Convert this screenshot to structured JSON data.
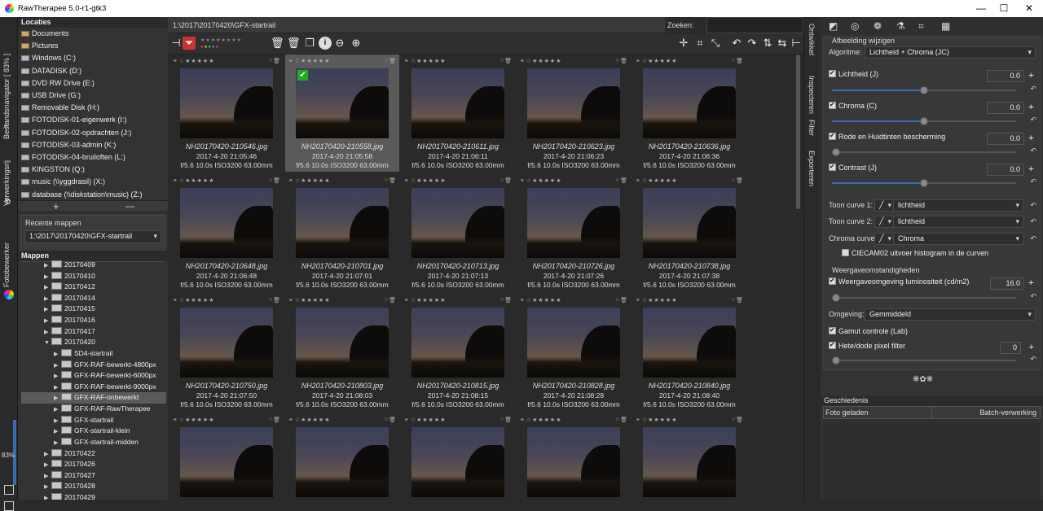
{
  "window": {
    "title": "RawTherapee 5.0-r1-gtk3",
    "controls": [
      "—",
      "☐",
      "✕"
    ]
  },
  "left_tabs": {
    "file_browser": "Bestandsnavigator [ 83% ]",
    "queue": "Verwerkingsrij",
    "editor": "Fotobewerker",
    "zoom_percent": "83%"
  },
  "places": {
    "header": "Locaties",
    "items": [
      {
        "label": "Documents",
        "kind": "folder"
      },
      {
        "label": "Pictures",
        "kind": "folder"
      },
      {
        "label": "Windows (C:)",
        "kind": "drive"
      },
      {
        "label": "DATADISK (D:)",
        "kind": "drive"
      },
      {
        "label": "DVD RW Drive (E:)",
        "kind": "drive"
      },
      {
        "label": "USB Drive (G:)",
        "kind": "drive"
      },
      {
        "label": "Removable Disk (H:)",
        "kind": "drive"
      },
      {
        "label": "FOTODISK-01-eigenwerk (I:)",
        "kind": "drive"
      },
      {
        "label": "FOTODISK-02-opdrachten (J:)",
        "kind": "drive"
      },
      {
        "label": "FOTODISK-03-admin (K:)",
        "kind": "drive"
      },
      {
        "label": "FOTODISK-04-bruiloften (L:)",
        "kind": "drive"
      },
      {
        "label": "KINGSTON (Q:)",
        "kind": "drive"
      },
      {
        "label": "music (\\\\yggdrasil) (X:)",
        "kind": "drive"
      },
      {
        "label": "database (\\\\diskstation\\music) (Z:)",
        "kind": "drive"
      }
    ],
    "add": "+",
    "remove": "—"
  },
  "recent": {
    "header": "Recente mappen",
    "value": "1:\\2017\\20170420\\GFX-startrail"
  },
  "tree": {
    "header": "Mappen",
    "nodes": [
      {
        "label": "20170409",
        "depth": 0,
        "open": false
      },
      {
        "label": "20170410",
        "depth": 0,
        "open": false
      },
      {
        "label": "20170412",
        "depth": 0,
        "open": false
      },
      {
        "label": "20170414",
        "depth": 0,
        "open": false
      },
      {
        "label": "20170415",
        "depth": 0,
        "open": false
      },
      {
        "label": "20170416",
        "depth": 0,
        "open": false
      },
      {
        "label": "20170417",
        "depth": 0,
        "open": false
      },
      {
        "label": "20170420",
        "depth": 0,
        "open": true
      },
      {
        "label": "SD4-startrail",
        "depth": 1,
        "open": false
      },
      {
        "label": "GFX-RAF-bewerkt-4800px",
        "depth": 1,
        "open": false
      },
      {
        "label": "GFX-RAF-bewerkt-6000px",
        "depth": 1,
        "open": false
      },
      {
        "label": "GFX-RAF-bewerkt-9000px",
        "depth": 1,
        "open": false
      },
      {
        "label": "GFX-RAF-onbewerkt",
        "depth": 1,
        "open": false,
        "selected": true
      },
      {
        "label": "GFX-RAF-RawTherapee",
        "depth": 1,
        "open": false
      },
      {
        "label": "GFX-startrail",
        "depth": 1,
        "open": false
      },
      {
        "label": "GFX-startrail-klein",
        "depth": 1,
        "open": false
      },
      {
        "label": "GFX-startrail-midden",
        "depth": 1,
        "open": false
      },
      {
        "label": "20170422",
        "depth": 0,
        "open": false
      },
      {
        "label": "20170426",
        "depth": 0,
        "open": false
      },
      {
        "label": "20170427",
        "depth": 0,
        "open": false
      },
      {
        "label": "20170428",
        "depth": 0,
        "open": false
      },
      {
        "label": "20170429",
        "depth": 0,
        "open": false
      }
    ]
  },
  "browser": {
    "path": "1:\\2017\\20170420\\GFX-startrail",
    "search_label": "Zoeken:",
    "thumbs": [
      {
        "name": "NH20170420-210546.jpg",
        "date": "2017-4-20 21:05:46",
        "exif": "f/5.6 10.0s ISO3200 63.00mm"
      },
      {
        "name": "NH20170420-210558.jpg",
        "date": "2017-4-20 21:05:58",
        "exif": "f/5.6 10.0s ISO3200 63.00mm",
        "selected": true
      },
      {
        "name": "NH20170420-210611.jpg",
        "date": "2017-4-20 21:06:11",
        "exif": "f/5.6 10.0s ISO3200 63.00mm"
      },
      {
        "name": "NH20170420-210623.jpg",
        "date": "2017-4-20 21:06:23",
        "exif": "f/5.6 10.0s ISO3200 63.00mm"
      },
      {
        "name": "NH20170420-210636.jpg",
        "date": "2017-4-20 21:06:36",
        "exif": "f/5.6 10.0s ISO3200 63.00mm"
      },
      {
        "name": "NH20170420-210648.jpg",
        "date": "2017-4-20 21:06:48",
        "exif": "f/5.6 10.0s ISO3200 63.00mm"
      },
      {
        "name": "NH20170420-210701.jpg",
        "date": "2017-4-20 21:07:01",
        "exif": "f/5.6 10.0s ISO3200 63.00mm"
      },
      {
        "name": "NH20170420-210713.jpg",
        "date": "2017-4-20 21:07:13",
        "exif": "f/5.6 10.0s ISO3200 63.00mm"
      },
      {
        "name": "NH20170420-210726.jpg",
        "date": "2017-4-20 21:07:26",
        "exif": "f/5.6 10.0s ISO3200 63.00mm"
      },
      {
        "name": "NH20170420-210738.jpg",
        "date": "2017-4-20 21:07:38",
        "exif": "f/5.6 10.0s ISO3200 63.00mm"
      },
      {
        "name": "NH20170420-210750.jpg",
        "date": "2017-4-20 21:07:50",
        "exif": "f/5.6 10.0s ISO3200 63.00mm"
      },
      {
        "name": "NH20170420-210803.jpg",
        "date": "2017-4-20 21:08:03",
        "exif": "f/5.6 10.0s ISO3200 63.00mm"
      },
      {
        "name": "NH20170420-210815.jpg",
        "date": "2017-4-20 21:08:15",
        "exif": "f/5.6 10.0s ISO3200 63.00mm"
      },
      {
        "name": "NH20170420-210828.jpg",
        "date": "2017-4-20 21:08:28",
        "exif": "f/5.6 10.0s ISO3200 63.00mm"
      },
      {
        "name": "NH20170420-210840.jpg",
        "date": "2017-4-20 21:08:40",
        "exif": "f/5.6 10.0s ISO3200 63.00mm"
      },
      {
        "name": "",
        "date": "",
        "exif": ""
      },
      {
        "name": "",
        "date": "",
        "exif": ""
      },
      {
        "name": "",
        "date": "",
        "exif": ""
      },
      {
        "name": "",
        "date": "",
        "exif": ""
      },
      {
        "name": "",
        "date": "",
        "exif": ""
      }
    ]
  },
  "right_tabs": {
    "tab1": "Ontwikkel",
    "tab2": "Inspecteren",
    "tab3": "Filter",
    "tab4": "Exporteren"
  },
  "tool": {
    "subtitle": "Afbeelding wijzigen",
    "algorithm_label": "Algoritme:",
    "algorithm_value": "Lichtheid + Chroma (JC)",
    "lightness": {
      "label": "Lichtheid (J)",
      "value": "0.0",
      "checked": true
    },
    "chroma": {
      "label": "Chroma (C)",
      "value": "0.0",
      "checked": true
    },
    "skin": {
      "label": "Rode en Huidtinten bescherming",
      "value": "0.0",
      "checked": true
    },
    "contrast": {
      "label": "Contrast (J)",
      "value": "0.0",
      "checked": true
    },
    "tone1_label": "Toon curve 1:",
    "tone1_value": "lichtheid",
    "tone2_label": "Toon curve 2:",
    "tone2_value": "lichtheid",
    "chroma_curve_label": "Chroma curve:",
    "chroma_curve_value": "Chroma",
    "histogram_check": "CIECAM02 uitvoer histogram in de curven",
    "viewing_header": "Weergaveomstandigheden",
    "surround_lum": {
      "label": "Weergaveomgeving luminositeit (cd/m2)",
      "value": "16.0",
      "checked": true
    },
    "surround_label": "Omgeving:",
    "surround_value": "Gemmiddeld",
    "gamut": "Gamut controle (Lab)",
    "hotdead": {
      "label": "Hete/dode pixel filter",
      "value": "0"
    },
    "ornament": "❋✿❋"
  },
  "history": {
    "header": "Geschiedenis",
    "col1": "Foto geladen",
    "col2": "Batch-verwerking"
  }
}
